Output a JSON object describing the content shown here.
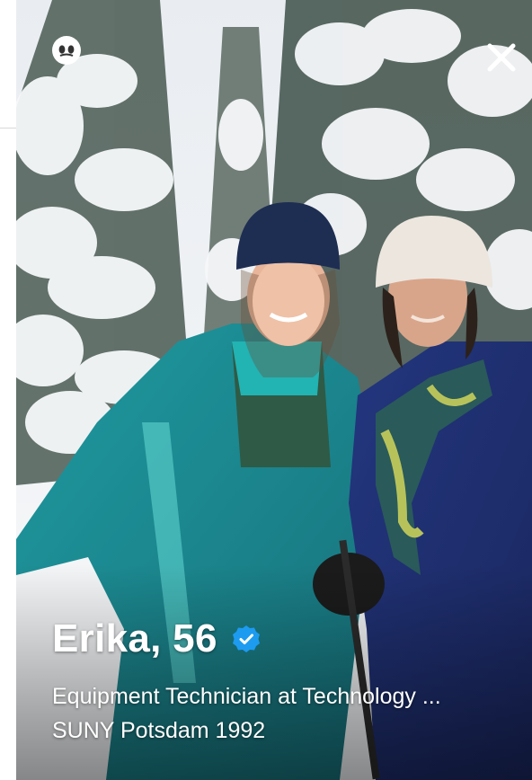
{
  "profile": {
    "name_age": "Erika, 56",
    "job": "Equipment Technician at Technology ...",
    "school": "SUNY Potsdam 1992",
    "verified": true
  },
  "icons": {
    "top_left": "chat-bubble-icon",
    "top_right": "close-icon",
    "badge": "verified-check-icon"
  },
  "colors": {
    "verified_blue": "#1d9bf0",
    "text": "#ffffff"
  }
}
